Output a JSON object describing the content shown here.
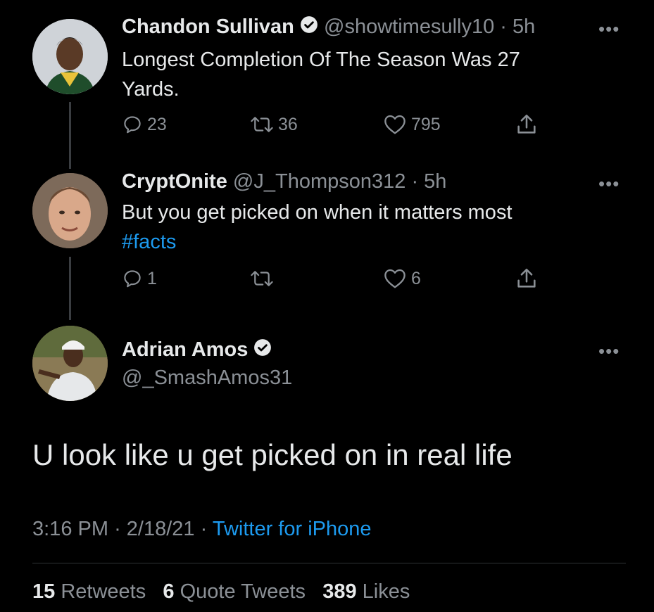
{
  "colors": {
    "background": "#000000",
    "text": "#e7e9ea",
    "muted": "#8b9096",
    "link": "#1d9bf0",
    "divider": "#2f3336"
  },
  "tweets": [
    {
      "display_name": "Chandon  Sullivan",
      "verified": true,
      "handle": "@showtimesully10",
      "time_sep": "·",
      "time": "5h",
      "text_line1": "Longest Completion Of The Season  Was 27",
      "text_line2": "Yards.",
      "replies": "23",
      "retweets": "36",
      "likes": "795",
      "avatar_icon": "person-avatar"
    },
    {
      "display_name": "CryptOnite",
      "verified": false,
      "handle": "@J_Thompson312",
      "time_sep": "·",
      "time": "5h",
      "text_line1": "But you get picked on when it matters most",
      "hashtag": "#facts",
      "replies": "1",
      "retweets": "",
      "likes": "6",
      "avatar_icon": "person-avatar"
    }
  ],
  "main_tweet": {
    "display_name": "Adrian Amos",
    "verified": true,
    "handle": "@_SmashAmos31",
    "text": "U look like u get picked on in real life",
    "time": "3:16 PM",
    "sep1": "·",
    "date": "2/18/21",
    "sep2": "·",
    "source": "Twitter for iPhone",
    "stats": {
      "retweets_count": "15",
      "retweets_label": "Retweets",
      "quotes_count": "6",
      "quotes_label": "Quote Tweets",
      "likes_count": "389",
      "likes_label": "Likes"
    }
  },
  "more_label": "•••"
}
